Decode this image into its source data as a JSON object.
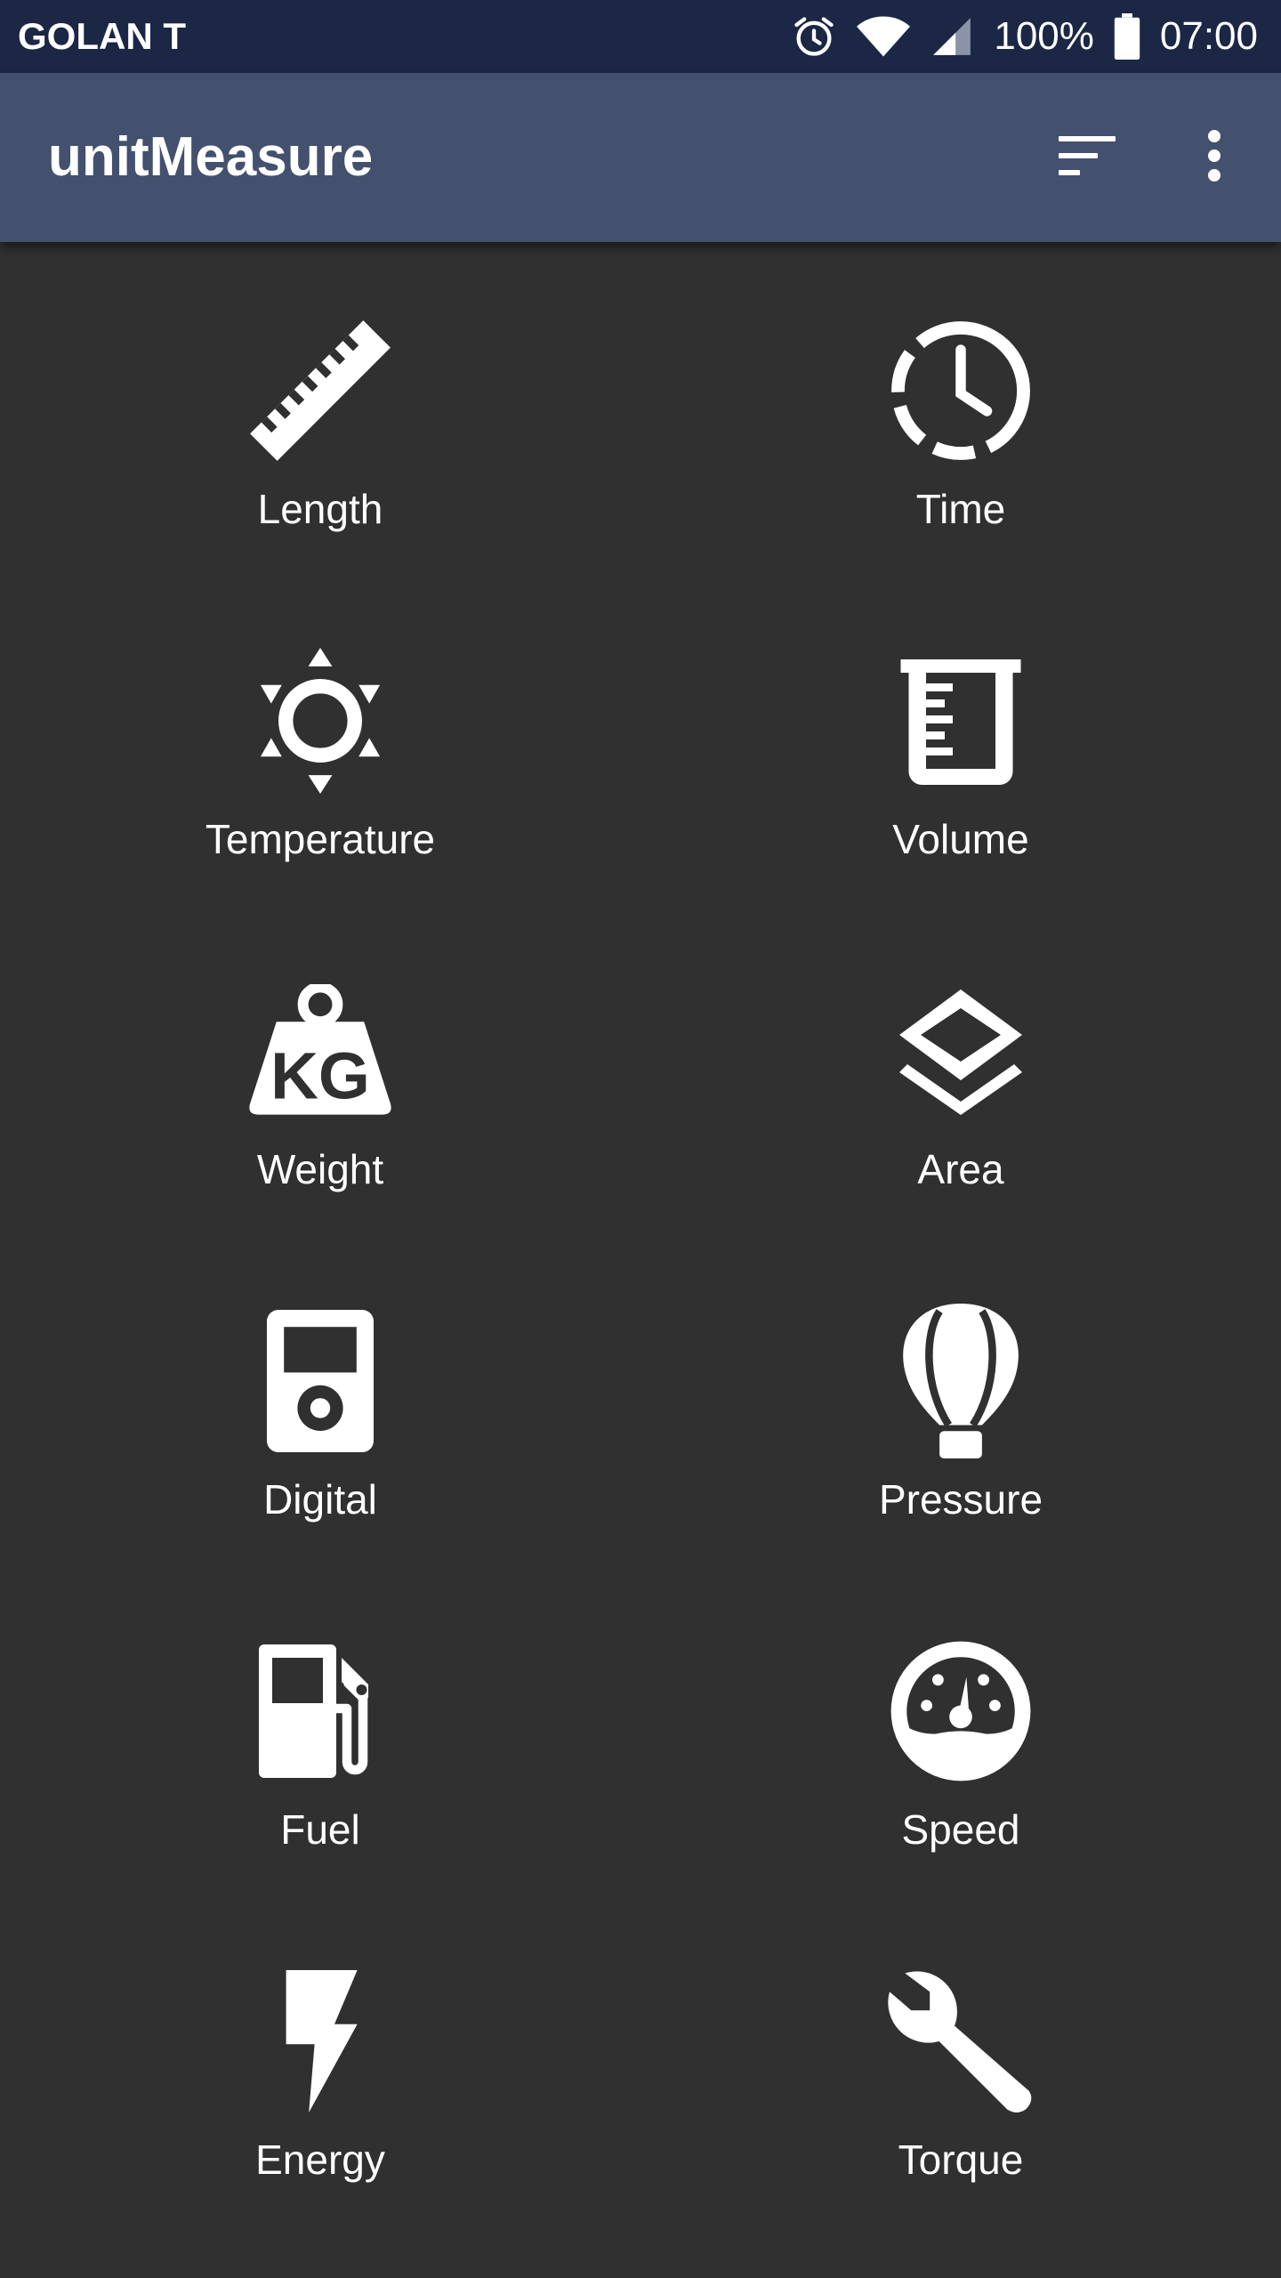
{
  "status_bar": {
    "carrier": "GOLAN T",
    "battery": "100%",
    "time": "07:00",
    "icons": [
      "alarm-icon",
      "wifi-icon",
      "signal-icon",
      "battery-icon"
    ]
  },
  "app_bar": {
    "title": "unitMeasure",
    "actions": [
      "sort-icon",
      "more-vert-icon"
    ]
  },
  "theme": {
    "status_bar_color": "#1b2745",
    "app_bar_color": "#43506e",
    "background_color": "#303030",
    "icon_color": "#ffffff"
  },
  "categories": [
    {
      "label": "Length",
      "icon": "ruler-icon"
    },
    {
      "label": "Time",
      "icon": "clock-icon"
    },
    {
      "label": "Temperature",
      "icon": "sun-icon"
    },
    {
      "label": "Volume",
      "icon": "beaker-icon"
    },
    {
      "label": "Weight",
      "icon": "kg-weight-icon"
    },
    {
      "label": "Area",
      "icon": "layers-icon"
    },
    {
      "label": "Digital",
      "icon": "ipod-icon"
    },
    {
      "label": "Pressure",
      "icon": "hot-air-balloon-icon"
    },
    {
      "label": "Fuel",
      "icon": "gas-pump-icon"
    },
    {
      "label": "Speed",
      "icon": "speedometer-icon"
    },
    {
      "label": "Energy",
      "icon": "lightning-icon"
    },
    {
      "label": "Torque",
      "icon": "wrench-icon"
    }
  ]
}
